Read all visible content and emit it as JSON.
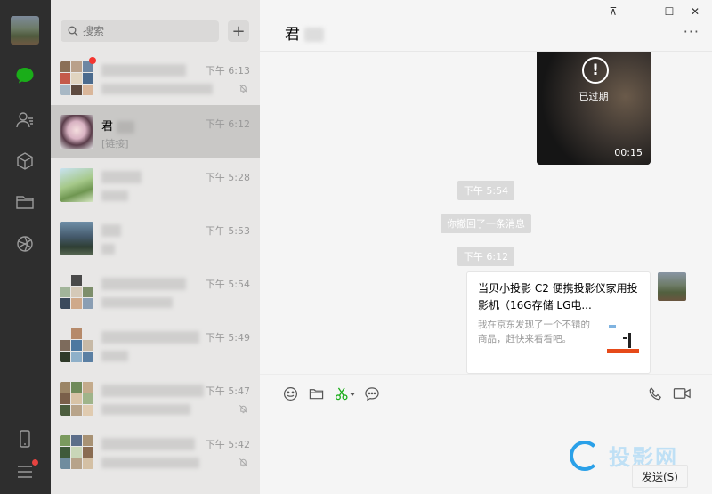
{
  "search": {
    "placeholder": "搜索",
    "add_label": "+"
  },
  "sessions": [
    {
      "name": "",
      "preview": "",
      "time": "下午 6:13",
      "muted": true,
      "unread": true
    },
    {
      "name": "君",
      "preview": "[链接]",
      "time": "下午 6:12",
      "muted": false,
      "unread": false,
      "selected": true
    },
    {
      "name": "",
      "preview": "",
      "time": "下午 5:28",
      "muted": false,
      "unread": false
    },
    {
      "name": "",
      "preview": "",
      "time": "下午 5:53",
      "muted": false,
      "unread": false
    },
    {
      "name": "",
      "preview": "",
      "time": "下午 5:54",
      "muted": false,
      "unread": false
    },
    {
      "name": "",
      "preview": "",
      "time": "下午 5:49",
      "muted": false,
      "unread": false
    },
    {
      "name": "",
      "preview": "",
      "time": "下午 5:47",
      "muted": true,
      "unread": false
    },
    {
      "name": "",
      "preview": "",
      "time": "下午 5:42",
      "muted": true,
      "unread": false
    }
  ],
  "chat": {
    "title": "君",
    "more": "···",
    "window_controls": {
      "pin": "⊼",
      "minimize": "—",
      "maximize": "☐",
      "close": "✕"
    },
    "video": {
      "status": "已过期",
      "duration": "00:15"
    },
    "system": [
      {
        "text": "下午 5:54"
      },
      {
        "text": "你撤回了一条消息"
      },
      {
        "text": "下午 6:12"
      }
    ],
    "card": {
      "title": "当贝小投影 C2 便携投影仪家用投影机（16G存储 LG电...",
      "description": "我在京东发现了一个不错的商品，赶快来看看吧。"
    },
    "send_label": "发送(S)",
    "watermark": "投影网"
  },
  "colors": {
    "accent": "#1aad19",
    "rail": "#2e2e2e",
    "badge": "#f43530"
  }
}
